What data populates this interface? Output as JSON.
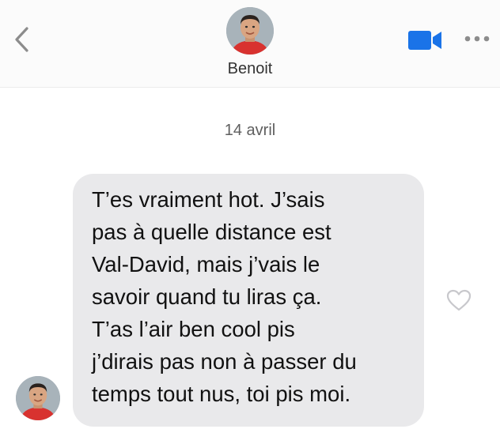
{
  "header": {
    "contact_name": "Benoit",
    "back_icon": "chevron-left-icon",
    "video_icon": "video-camera-icon",
    "more_icon": "more-dots-icon",
    "accent_color": "#1a73e8"
  },
  "conversation": {
    "date_label": "14 avril",
    "message": {
      "lines": [
        "T’es vraiment hot. J’sais",
        "pas à quelle distance est",
        "Val-David, mais j’vais le",
        "savoir quand tu liras ça.",
        "T’as l’air ben cool pis",
        "j’dirais pas non à passer du",
        "temps tout nus, toi pis moi."
      ],
      "bubble_color": "#e9e9eb",
      "like_icon": "heart-outline-icon"
    }
  }
}
